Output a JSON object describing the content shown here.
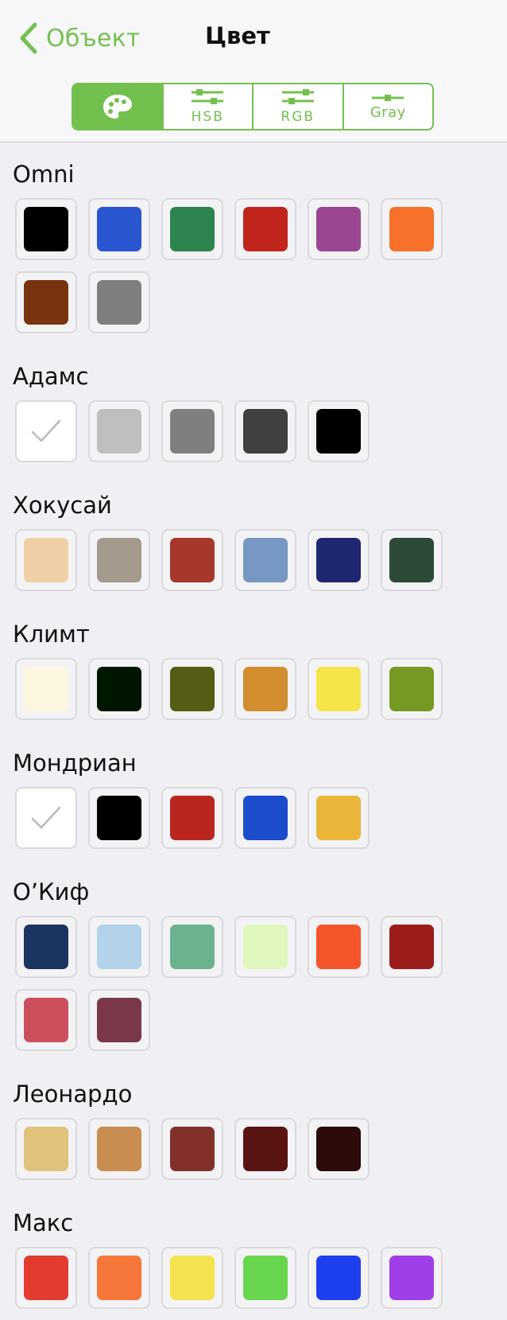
{
  "nav": {
    "back_label": "Объект",
    "title": "Цвет"
  },
  "tabs": [
    {
      "name": "palette",
      "label": "",
      "icon": "palette-icon",
      "active": true
    },
    {
      "name": "hsb",
      "label": "HSB",
      "icon": "sliders-icon",
      "active": false
    },
    {
      "name": "rgb",
      "label": "RGB",
      "icon": "sliders-icon",
      "active": false
    },
    {
      "name": "gray",
      "label": "Gray",
      "icon": "slider-icon",
      "active": false
    }
  ],
  "accent": "#74c04f",
  "groups": [
    {
      "title": "Omni",
      "colors": [
        "#000000",
        "#2a56d1",
        "#2d8450",
        "#c0241d",
        "#9b4692",
        "#f7712a",
        "#7a3310",
        "#7f7f7f"
      ]
    },
    {
      "title": "Адамс",
      "colors": [
        "#ffffff",
        "#bfbfbf",
        "#7f7f7f",
        "#404040",
        "#000000"
      ],
      "selected": 0
    },
    {
      "title": "Хокусай",
      "colors": [
        "#efd0a6",
        "#a39a8c",
        "#a6372a",
        "#7898c4",
        "#1f2772",
        "#2d4a37"
      ]
    },
    {
      "title": "Климт",
      "colors": [
        "#fdf6e0",
        "#001600",
        "#565c13",
        "#d18d2e",
        "#f4e44a",
        "#759a24"
      ]
    },
    {
      "title": "Мондриан",
      "colors": [
        "#ffffff",
        "#000000",
        "#bb2520",
        "#1a4ccc",
        "#eab63a"
      ],
      "selected": 0
    },
    {
      "title": "О’Киф",
      "colors": [
        "#1b3460",
        "#b2d3e9",
        "#6db28e",
        "#dff7bc",
        "#f4552a",
        "#9b1d19",
        "#cc4f5d",
        "#7b384a"
      ]
    },
    {
      "title": "Леонардо",
      "colors": [
        "#e1c27a",
        "#c98d50",
        "#83302c",
        "#5a1414",
        "#2d0b0a"
      ]
    },
    {
      "title": "Макс",
      "colors": [
        "#e23b30",
        "#f7773a",
        "#f4e34e",
        "#67d64e",
        "#1e3ff0",
        "#a03fe8"
      ]
    }
  ]
}
